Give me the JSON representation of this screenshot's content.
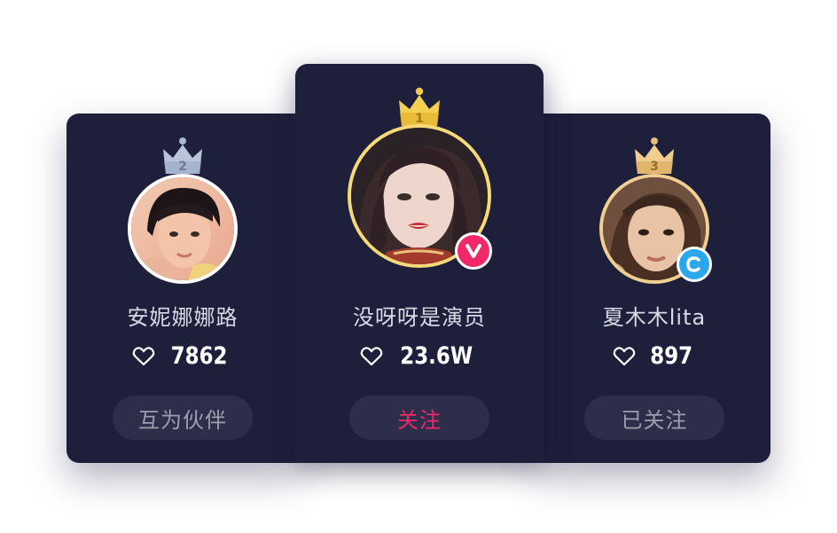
{
  "ranking": [
    {
      "rank": "2",
      "name": "安妮娜娜路",
      "likes": "7862",
      "action": "互为伙伴",
      "crown_color": "#a9b7cf",
      "ring_color": "#ffffff"
    },
    {
      "rank": "1",
      "name": "没呀呀是演员",
      "likes": "23.6W",
      "action": "关注",
      "crown_color": "#f2c94c",
      "ring_color": "#f7d978",
      "badge": "v-badge-icon",
      "badge_color": "#f0286a"
    },
    {
      "rank": "3",
      "name": "夏木木lita",
      "likes": "897",
      "action": "已关注",
      "crown_color": "#e8c07a",
      "ring_color": "#f1cf93",
      "badge": "c-badge-icon",
      "badge_color": "#2aa7ef"
    }
  ],
  "colors": {
    "card_bg": "#1e1f3b",
    "button_bg": "#2d2e49",
    "follow_text": "#f0286a",
    "muted_text": "#9d9eb0"
  }
}
